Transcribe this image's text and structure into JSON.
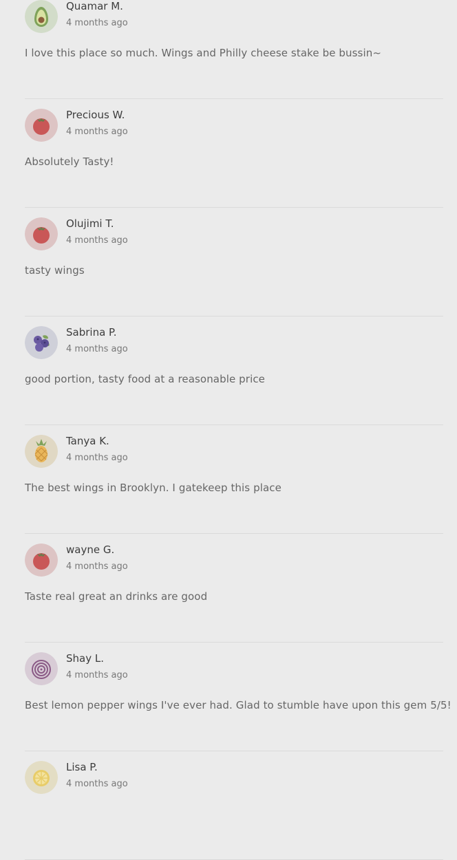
{
  "reviews": [
    {
      "name": "Quamar M.",
      "time": "4 months ago",
      "text": "I love this place so much. Wings and Philly cheese stake be bussin~",
      "avatar": "avocado-icon"
    },
    {
      "name": "Precious W.",
      "time": "4 months ago",
      "text": "Absolutely Tasty!",
      "avatar": "tomato-icon"
    },
    {
      "name": "Olujimi T.",
      "time": "4 months ago",
      "text": "tasty wings",
      "avatar": "tomato-icon"
    },
    {
      "name": "Sabrina P.",
      "time": "4 months ago",
      "text": "good portion, tasty food at a reasonable price",
      "avatar": "blueberry-icon"
    },
    {
      "name": "Tanya K.",
      "time": "4 months ago",
      "text": "The best wings in Brooklyn. I gatekeep this place",
      "avatar": "pineapple-icon"
    },
    {
      "name": "wayne G.",
      "time": "4 months ago",
      "text": "Taste real great an drinks are good",
      "avatar": "tomato-icon"
    },
    {
      "name": "Shay L.",
      "time": "4 months ago",
      "text": "Best lemon pepper wings I've ever had. Glad to stumble have upon this gem 5/5!",
      "avatar": "onion-icon"
    },
    {
      "name": "Lisa P.",
      "time": "4 months ago",
      "text": "",
      "avatar": "lemon-icon"
    }
  ],
  "colors": {
    "page_background": "#ebebeb",
    "divider": "#dadada",
    "name_text": "#3d3d3d",
    "body_text": "#666666",
    "meta_text": "#777777"
  }
}
